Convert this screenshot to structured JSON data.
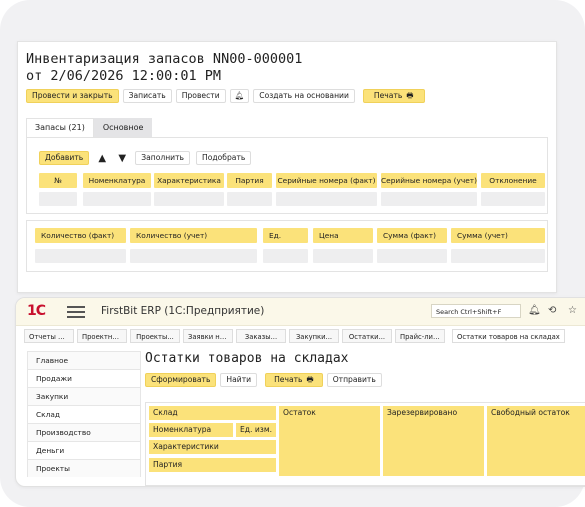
{
  "document": {
    "title_line1": "Инвентаризация запасов NN00-000001",
    "title_line2": "от 2/06/2026 12:00:01 PM",
    "toolbar": {
      "post_close": "Провести и закрыть",
      "save": "Записать",
      "post": "Провести",
      "create_based": "Создать на основании",
      "print": "Печать"
    },
    "tabs": [
      "Запасы (21)",
      "Основное"
    ],
    "items_tools": {
      "add": "Добавить",
      "fill": "Заполнить",
      "select": "Подобрать"
    },
    "columns": [
      "№",
      "Номенклатура",
      "Характеристика",
      "Партия",
      "Серийные номера (факт)",
      "Серийные номера (учет)",
      "Отклонение"
    ],
    "columns2": [
      "Количество (факт)",
      "Количество (учет)",
      "Ед.",
      "Цена",
      "Сумма (факт)",
      "Сумма (учет)"
    ]
  },
  "app": {
    "logo": "1С",
    "name": "FirstBit ERP (1С:Предприятие)",
    "search_placeholder": "Search Ctrl+Shift+F",
    "open_tabs": [
      "Отчеты по...",
      "Проектные...",
      "Проекты...",
      "Заявки на...",
      "Заказы...",
      "Закупки...",
      "Остатки...",
      "Прайс-лист..."
    ],
    "active_tab": "Остатки товаров на складах",
    "sidebar": [
      "Главное",
      "Продажи",
      "Закупки",
      "Склад",
      "Производство",
      "Деньги",
      "Проекты"
    ],
    "report": {
      "title": "Остатки товаров на складах",
      "generate": "Сформировать",
      "find": "Найти",
      "print": "Печать",
      "send": "Отправить",
      "headers": {
        "warehouse": "Склад",
        "nomenclature": "Номенклатура",
        "unit": "Ед. изм.",
        "characteristics": "Характеристики",
        "batch": "Партия",
        "balance": "Остаток",
        "reserved": "Зарезервировано",
        "free": "Свободный остаток"
      }
    }
  },
  "colors": {
    "accent": "#fbe27a",
    "logo": "#c8102e"
  }
}
